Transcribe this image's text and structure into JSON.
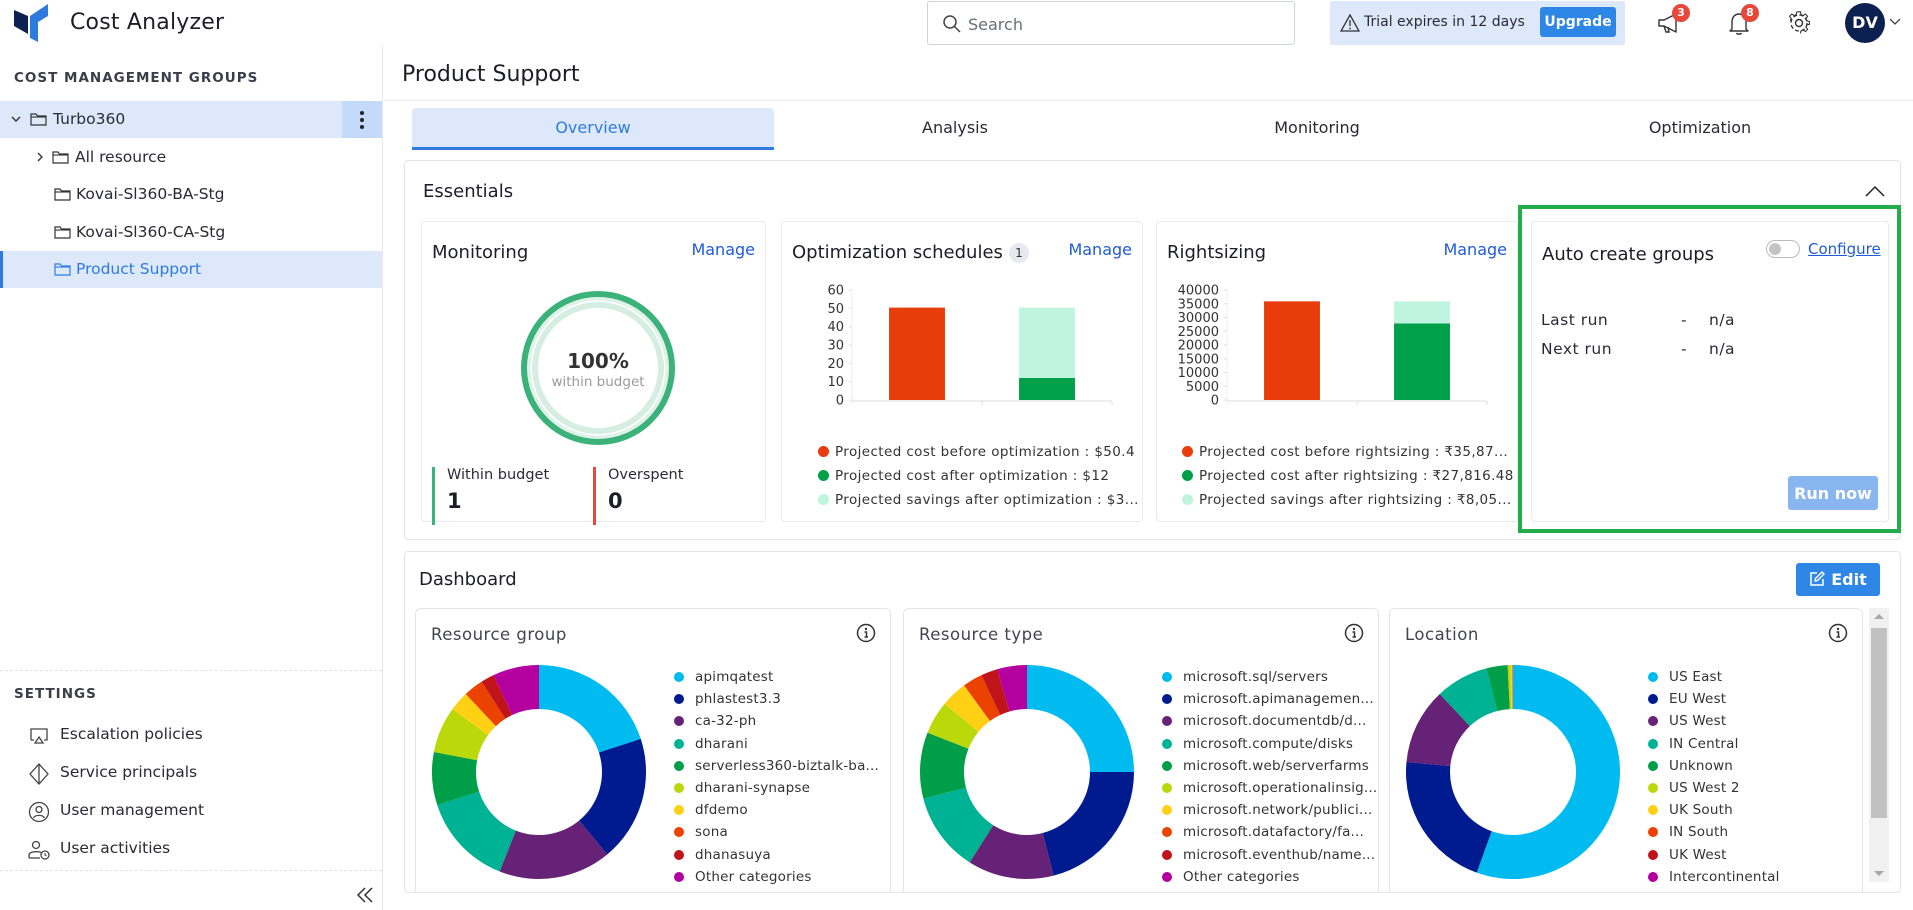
{
  "app": {
    "title": "Cost Analyzer",
    "brand_color": "#2e7be0"
  },
  "header": {
    "search_placeholder": "Search",
    "search_value": "",
    "trial_text": "Trial expires in 12 days",
    "upgrade_label": "Upgrade",
    "announcements_count": "3",
    "notifications_count": "8",
    "avatar_initials": "DV"
  },
  "sidebar": {
    "groups_heading": "COST MANAGEMENT GROUPS",
    "tree": [
      {
        "label": "Turbo360",
        "expanded": true
      },
      {
        "label": "All resource",
        "expanded": false
      },
      {
        "label": "Kovai-Sl360-BA-Stg"
      },
      {
        "label": "Kovai-Sl360-CA-Stg"
      },
      {
        "label": "Product Support",
        "selected": true
      }
    ],
    "settings_heading": "SETTINGS",
    "settings": [
      {
        "label": "Escalation policies",
        "icon": "escalation-icon"
      },
      {
        "label": "Service principals",
        "icon": "service-principal-icon"
      },
      {
        "label": "User management",
        "icon": "user-circle-icon"
      },
      {
        "label": "User activities",
        "icon": "user-clock-icon"
      }
    ]
  },
  "main": {
    "page_title": "Product Support",
    "tabs": [
      {
        "label": "Overview",
        "active": true
      },
      {
        "label": "Analysis"
      },
      {
        "label": "Monitoring"
      },
      {
        "label": "Optimization"
      }
    ],
    "essentials": {
      "title": "Essentials",
      "monitoring": {
        "title": "Monitoring",
        "manage_label": "Manage",
        "percent_text": "100%",
        "percent_caption": "within budget",
        "within_budget_fraction": 1.0,
        "within_budget_label": "Within budget",
        "within_budget_value": "1",
        "overspent_label": "Overspent",
        "overspent_value": "0"
      },
      "auto_create": {
        "title": "Auto create groups",
        "toggle_on": false,
        "configure_label": "Configure",
        "last_run_label": "Last run",
        "last_run_dash": "-",
        "last_run_value": "n/a",
        "next_run_label": "Next run",
        "next_run_dash": "-",
        "next_run_value": "n/a",
        "run_now_label": "Run now"
      }
    },
    "dashboard": {
      "title": "Dashboard",
      "edit_label": "Edit"
    }
  },
  "chart_data": [
    {
      "id": "optimization-schedules",
      "type": "bar",
      "title": "Optimization schedules",
      "title_badge": "1",
      "manage_label": "Manage",
      "ylim": [
        0,
        60
      ],
      "yticks": [
        0,
        10,
        20,
        30,
        40,
        50,
        60
      ],
      "stacked": true,
      "bars": [
        {
          "segments": [
            {
              "series": 0,
              "value": 50.4
            }
          ]
        },
        {
          "segments": [
            {
              "series": 1,
              "value": 12
            },
            {
              "series": 2,
              "value": 38.4
            }
          ]
        }
      ],
      "series": [
        {
          "name": "Projected cost before optimization",
          "legend": "Projected cost before optimization : $50.4",
          "color": "#e83c0c"
        },
        {
          "name": "Projected cost after optimization",
          "legend": "Projected cost after optimization : $12",
          "color": "#00a04a"
        },
        {
          "name": "Projected savings after optimization",
          "legend": "Projected savings after optimization : $3...",
          "color": "#bff5e0"
        }
      ]
    },
    {
      "id": "rightsizing",
      "type": "bar",
      "title": "Rightsizing",
      "manage_label": "Manage",
      "ylim": [
        0,
        40000
      ],
      "yticks": [
        0,
        5000,
        10000,
        15000,
        20000,
        25000,
        30000,
        35000,
        40000
      ],
      "stacked": true,
      "bars": [
        {
          "segments": [
            {
              "series": 0,
              "value": 35870
            }
          ]
        },
        {
          "segments": [
            {
              "series": 1,
              "value": 27816.48
            },
            {
              "series": 2,
              "value": 8053
            }
          ]
        }
      ],
      "series": [
        {
          "name": "Projected cost before rightsizing",
          "legend": "Projected cost before rightsizing : ₹35,87...",
          "color": "#e83c0c"
        },
        {
          "name": "Projected cost after rightsizing",
          "legend": "Projected cost after rightsizing : ₹27,816.48",
          "color": "#00a04a"
        },
        {
          "name": "Projected savings after rightsizing",
          "legend": "Projected savings after rightsizing : ₹8,05...",
          "color": "#bff5e0"
        }
      ]
    },
    {
      "id": "resource-group",
      "type": "pie",
      "donut": true,
      "title": "Resource group",
      "labels": [
        "apimqatest",
        "phlastest3.3",
        "ca-32-ph",
        "dharani",
        "serverless360-biztalk-ba...",
        "dharani-synapse",
        "dfdemo",
        "sona",
        "dhanasuya",
        "Other categories"
      ],
      "values": [
        20,
        19,
        17,
        14,
        8,
        7,
        3,
        3,
        2,
        7
      ],
      "colors": [
        "#00bbf0",
        "#001a8f",
        "#662277",
        "#00b294",
        "#009e49",
        "#bad80a",
        "#ffd014",
        "#ec4200",
        "#c0131a",
        "#b4009e"
      ]
    },
    {
      "id": "resource-type",
      "type": "pie",
      "donut": true,
      "title": "Resource type",
      "labels": [
        "microsoft.sql/servers",
        "microsoft.apimanagemen...",
        "microsoft.documentdb/d...",
        "microsoft.compute/disks",
        "microsoft.web/serverfarms",
        "microsoft.operationalinsig...",
        "microsoft.network/publici...",
        "microsoft.datafactory/fa...",
        "microsoft.eventhub/name...",
        "Other categories"
      ],
      "values": [
        25,
        21,
        13,
        12,
        10,
        5,
        4,
        3,
        2.5,
        4.5
      ],
      "colors": [
        "#00bbf0",
        "#001a8f",
        "#662277",
        "#00b294",
        "#009e49",
        "#bad80a",
        "#ffd014",
        "#ec4200",
        "#c0131a",
        "#b4009e"
      ]
    },
    {
      "id": "location",
      "type": "pie",
      "donut": true,
      "title": "Location",
      "labels": [
        "US East",
        "EU West",
        "US West",
        "IN Central",
        "Unknown",
        "US West 2",
        "UK South",
        "IN South",
        "UK West",
        "Intercontinental"
      ],
      "values": [
        55.5,
        21,
        11.5,
        8,
        3.2,
        0.4,
        0.3,
        0.05,
        0.03,
        0.02
      ],
      "colors": [
        "#00bbf0",
        "#001a8f",
        "#662277",
        "#00b294",
        "#009e49",
        "#bad80a",
        "#ffd014",
        "#ec4200",
        "#c0131a",
        "#b4009e"
      ]
    }
  ]
}
